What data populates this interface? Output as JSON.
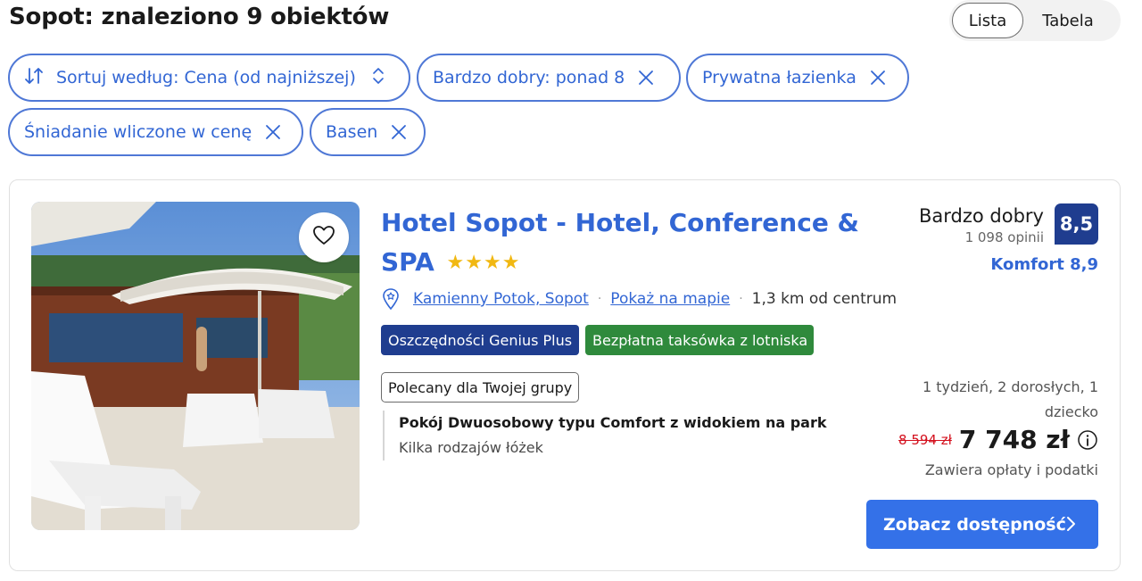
{
  "header": {
    "results_title": "Sopot: znaleziono 9 obiektów",
    "view_toggle": {
      "list_label": "Lista",
      "table_label": "Tabela",
      "active": "Lista"
    }
  },
  "filters": {
    "sort_label": "Sortuj według: Cena (od najniższej)",
    "chips": [
      {
        "label": "Bardzo dobry: ponad 8"
      },
      {
        "label": "Prywatna łazienka"
      },
      {
        "label": "Śniadanie wliczone w cenę"
      },
      {
        "label": "Basen"
      }
    ]
  },
  "property": {
    "name": "Hotel Sopot - Hotel, Conference & SPA",
    "stars": 4,
    "stars_glyphs": "★★★★",
    "location_link": "Kamienny Potok, Sopot",
    "map_link": "Pokaż na mapie",
    "distance": "1,3 km od centrum",
    "badges": {
      "genius": "Oszczędności Genius Plus",
      "taxi": "Bezpłatna taksówka z lotniska"
    },
    "recommended_badge": "Polecany dla Twojej grupy",
    "room_name": "Pokój Dwuosobowy typu Comfort z widokiem na park",
    "room_beds": "Kilka rodzajów łóżek",
    "review": {
      "word": "Bardzo dobry",
      "count": "1 098 opinii",
      "score": "8,5",
      "comfort": "Komfort 8,9"
    },
    "stay_info": "1 tydzień, 2 dorosłych, 1 dziecko",
    "old_price": "8 594 zł",
    "price": "7 748 zł",
    "taxes": "Zawiera opłaty i podatki",
    "cta_label": "Zobacz dostępność"
  },
  "colors": {
    "brand_blue": "#3266d4",
    "genius_navy": "#1f3d8f",
    "taxi_green": "#2f8a3c",
    "cta_blue": "#3471e8",
    "old_price_red": "#d4111e",
    "star_gold": "#f1b812"
  },
  "icons": [
    "sort-icon",
    "updown-icon",
    "close-icon",
    "heart-icon",
    "location-pin-icon",
    "info-icon",
    "chevron-right-icon"
  ]
}
